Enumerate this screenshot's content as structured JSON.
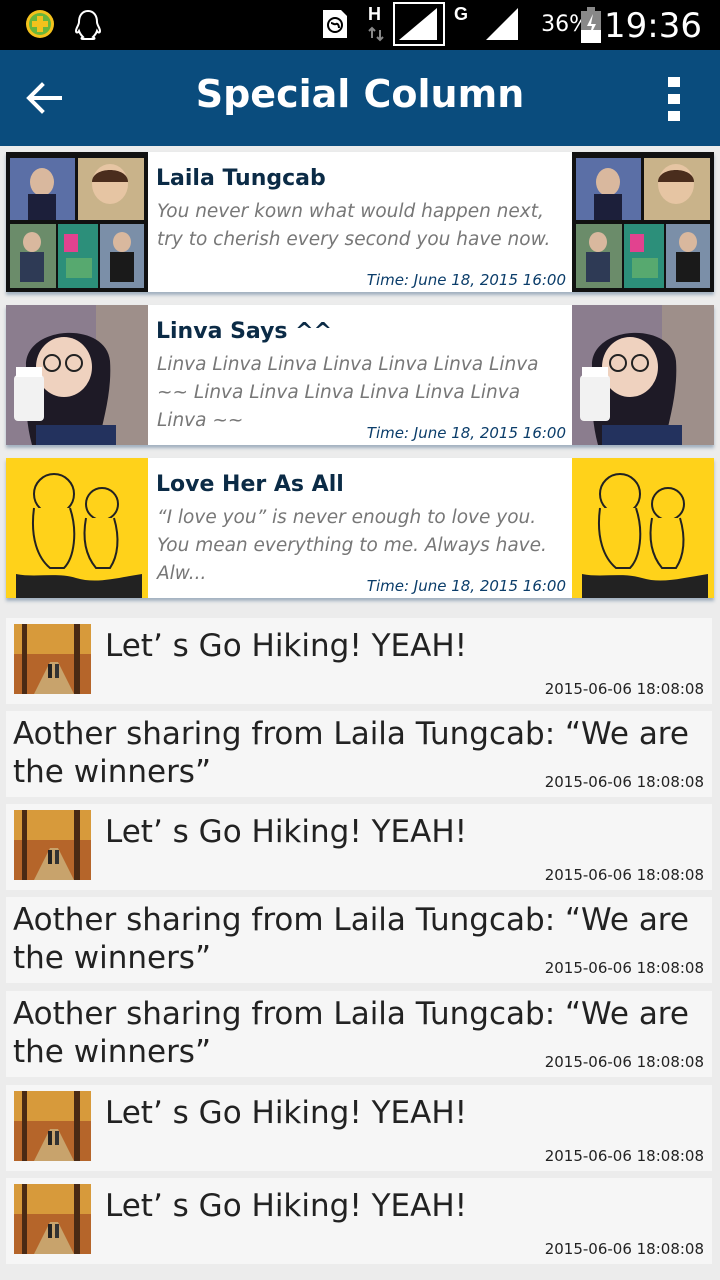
{
  "status_bar": {
    "time": "19:36",
    "battery_percent": "36%",
    "network_h": "H",
    "network_g": "G"
  },
  "app_bar": {
    "title": "Special Column",
    "back_icon": "arrow-left-icon",
    "menu_icon": "more-vertical-icon"
  },
  "featured": [
    {
      "name": "Laila Tungcab",
      "desc": "You never kown what would happen next, try to cherish every second you have now.",
      "time": "Time: June 18, 2015 16:00",
      "thumb": "photo-collage"
    },
    {
      "name": "Linva Says ^^",
      "desc": "Linva Linva Linva Linva Linva Linva Linva ~~ Linva Linva Linva Linva Linva Linva Linva ~~",
      "time": "Time: June 18, 2015 16:00",
      "thumb": "girl-photo"
    },
    {
      "name": "Love Her As All",
      "desc": "“I love you” is never enough to love you. You mean everything to me. Always have. Alw...",
      "time": "Time: June 18, 2015 16:00",
      "thumb": "cartoon-couple"
    }
  ],
  "posts": [
    {
      "title": "Let’ s Go Hiking! YEAH!",
      "date": "2015-06-06 18:08:08",
      "has_image": true
    },
    {
      "title": "Aother sharing from Laila Tungcab: “We are the winners”",
      "date": "2015-06-06 18:08:08",
      "has_image": false
    },
    {
      "title": "Let’ s Go Hiking! YEAH!",
      "date": "2015-06-06 18:08:08",
      "has_image": true
    },
    {
      "title": "Aother sharing from Laila Tungcab: “We are the winners”",
      "date": "2015-06-06 18:08:08",
      "has_image": false
    },
    {
      "title": "Aother sharing from Laila Tungcab: “We are the winners”",
      "date": "2015-06-06 18:08:08",
      "has_image": false
    },
    {
      "title": "Let’ s Go Hiking! YEAH!",
      "date": "2015-06-06 18:08:08",
      "has_image": true
    },
    {
      "title": "Let’ s Go Hiking! YEAH!",
      "date": "2015-06-06 18:08:08",
      "has_image": true
    }
  ],
  "colors": {
    "app_bar": "#0a4c7d",
    "title_text": "#ffffff",
    "card_name": "#0b2b46",
    "card_time": "#0b3d6a",
    "list_bg": "#f6f6f6"
  }
}
